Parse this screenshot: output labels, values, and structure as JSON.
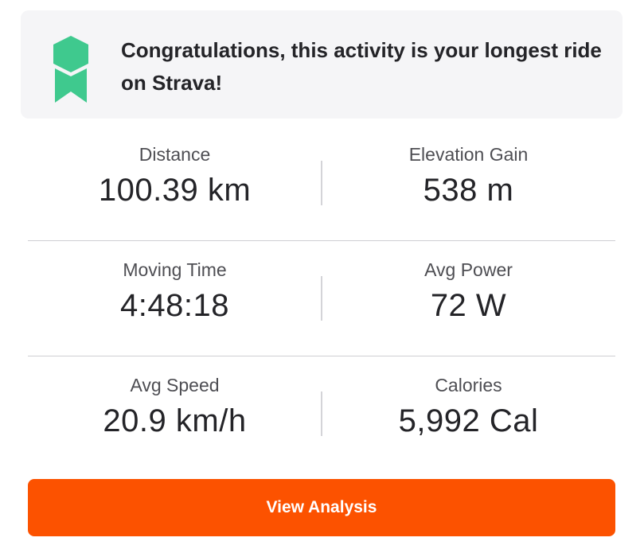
{
  "banner": {
    "icon": "award-ribbon-icon",
    "icon_color": "#3fc98e",
    "message": "Congratulations, this activity is your longest ride on Strava!"
  },
  "stats": [
    {
      "left": {
        "label": "Distance",
        "value": "100.39 km"
      },
      "right": {
        "label": "Elevation Gain",
        "value": "538 m"
      }
    },
    {
      "left": {
        "label": "Moving Time",
        "value": "4:48:18"
      },
      "right": {
        "label": "Avg Power",
        "value": "72 W"
      }
    },
    {
      "left": {
        "label": "Avg Speed",
        "value": "20.9 km/h"
      },
      "right": {
        "label": "Calories",
        "value": "5,992 Cal"
      }
    }
  ],
  "cta": {
    "label": "View Analysis",
    "color": "#fc5200"
  }
}
